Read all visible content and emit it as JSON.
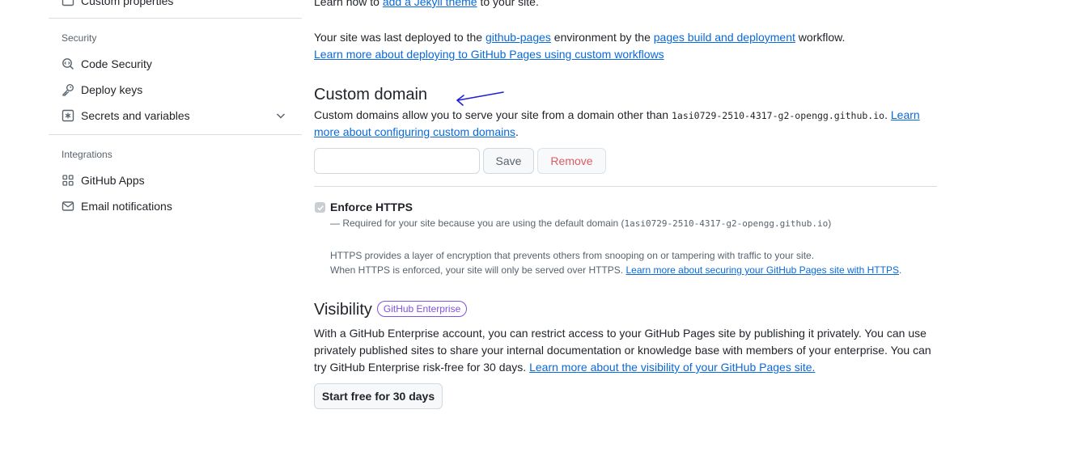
{
  "sidebar": {
    "partial_item": "Custom properties",
    "security_heading": "Security",
    "security_items": [
      {
        "label": "Code Security",
        "icon": "codescan-icon"
      },
      {
        "label": "Deploy keys",
        "icon": "key-icon"
      },
      {
        "label": "Secrets and variables",
        "icon": "asterisk-icon"
      }
    ],
    "integrations_heading": "Integrations",
    "integration_items": [
      {
        "label": "GitHub Apps",
        "icon": "apps-icon"
      },
      {
        "label": "Email notifications",
        "icon": "mail-icon"
      }
    ]
  },
  "deploy": {
    "top_partial_pre": "Learn how to ",
    "top_partial_link": "add a Jekyll theme",
    "top_partial_post": " to your site.",
    "text_1": "Your site was last deployed to the ",
    "env_link": "github-pages",
    "text_2": " environment by the ",
    "workflow_link": "pages build and deployment",
    "text_3": " workflow.",
    "learn_link": "Learn more about deploying to GitHub Pages using custom workflows"
  },
  "custom_domain": {
    "title": "Custom domain",
    "desc_pre": "Custom domains allow you to serve your site from a domain other than ",
    "default_domain": "1asi0729-2510-4317-g2-opengg.github.io",
    "desc_post": ". ",
    "learn_link_1": "Learn",
    "learn_link_2": "more about configuring custom domains",
    "desc_end": ".",
    "input_value": "",
    "save_label": "Save",
    "remove_label": "Remove"
  },
  "https": {
    "label": "Enforce HTTPS",
    "checked": true,
    "required_pre": "— Required for your site because you are using the default domain (",
    "required_domain": "1asi0729-2510-4317-g2-opengg.github.io",
    "required_post": ")",
    "desc_1": "HTTPS provides a layer of encryption that prevents others from snooping on or tampering with traffic to your site.",
    "desc_2": "When HTTPS is enforced, your site will only be served over HTTPS. ",
    "learn_link": "Learn more about securing your GitHub Pages site with HTTPS",
    "desc_end": "."
  },
  "visibility": {
    "title": "Visibility",
    "badge": "GitHub Enterprise",
    "line_1": "With a GitHub Enterprise account, you can restrict access to your GitHub Pages site by publishing it privately. You can use",
    "line_2": "privately published sites to share your internal documentation or knowledge base with members of your enterprise. You can",
    "line_3": "try GitHub Enterprise risk-free for 30 days. ",
    "learn_link": "Learn more about the visibility of your GitHub Pages site.",
    "button": "Start free for 30 days"
  },
  "colors": {
    "link": "#0969da",
    "badge": "#8250df",
    "danger": "#d1242f",
    "annotation": "#1f1fd6"
  }
}
